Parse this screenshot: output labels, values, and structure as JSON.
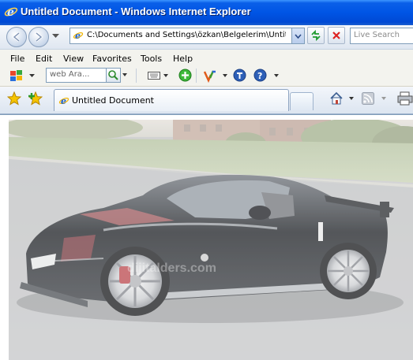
{
  "window": {
    "title": "Untitled Document - Windows Internet Explorer"
  },
  "address_bar": {
    "url": "C:\\Documents and Settings\\özkan\\Belgelerim\\Untitled"
  },
  "search_box": {
    "placeholder": "Live Search"
  },
  "menu": {
    "items": [
      "File",
      "Edit",
      "View",
      "Favorites",
      "Tools",
      "Help"
    ]
  },
  "toolbar": {
    "web_search_placeholder": "web Ara..."
  },
  "tabs": [
    {
      "label": "Untitled Document"
    }
  ],
  "content": {
    "watermark": "dijitalders.com",
    "photo_icon": "black-sports-car-photo"
  },
  "colors": {
    "titlebar": "#0055e5",
    "accent": "#3d95ff"
  }
}
